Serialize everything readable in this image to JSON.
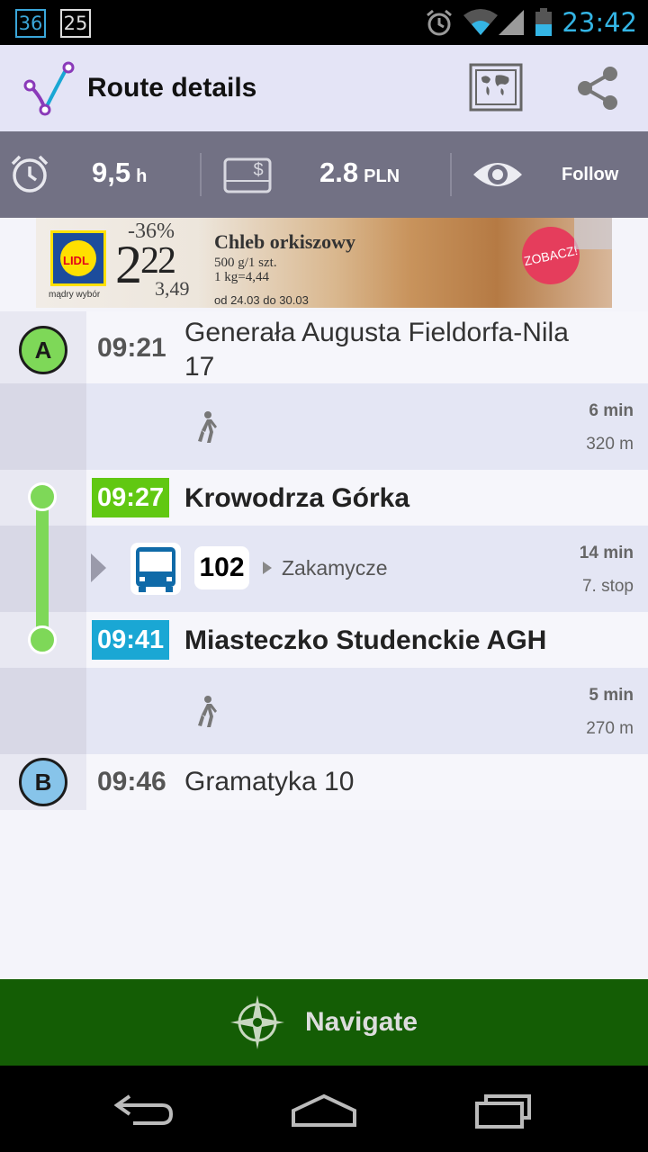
{
  "status_bar": {
    "notifications": [
      "36",
      "25"
    ],
    "time": "23:42",
    "icons": [
      "alarm-icon",
      "wifi-icon",
      "signal-icon",
      "battery-icon"
    ]
  },
  "action_bar": {
    "title": "Route details",
    "icons": [
      "app-logo-icon",
      "map-icon",
      "share-icon"
    ]
  },
  "summary": {
    "duration_value": "9,5",
    "duration_unit": "h",
    "price_value": "2.8",
    "price_unit": "PLN",
    "follow_label": "Follow",
    "icons": [
      "alarm-clock-icon",
      "ticket-icon",
      "eye-icon"
    ]
  },
  "ad": {
    "brand": "LIDL",
    "tagline": "mądry wybór",
    "discount": "-36%",
    "price_int": "2",
    "price_dec": "22",
    "old_price": "3,49",
    "product": "Chleb orkiszowy",
    "size": "500 g/1 szt.",
    "unit_price": "1 kg=4,44",
    "dates": "od 24.03 do 30.03",
    "cta": "ZOBACZ!"
  },
  "route": {
    "start": {
      "marker": "A",
      "time": "09:21",
      "name_line1": "Generała Augusta Fieldorfa-Nila",
      "name_line2": "17"
    },
    "walk1": {
      "duration": "6 min",
      "distance": "320 m"
    },
    "board": {
      "time": "09:27",
      "name": "Krowodrza Górka"
    },
    "ride": {
      "line": "102",
      "direction": "Zakamycze",
      "duration": "14 min",
      "stops": "7. stop"
    },
    "alight": {
      "time": "09:41",
      "name": "Miasteczko Studenckie AGH"
    },
    "walk2": {
      "duration": "5 min",
      "distance": "270 m"
    },
    "end": {
      "marker": "B",
      "time": "09:46",
      "name": "Gramatyka 10"
    }
  },
  "navigate": {
    "label": "Navigate"
  },
  "colors": {
    "action_bar": "#e4e4f6",
    "summary_bar": "#727184",
    "ride_green": "#7ed858",
    "board_badge": "#61c812",
    "alight_badge": "#1aa7d4",
    "navigate_bg": "#145d05",
    "status_accent": "#34b5e5"
  },
  "system_nav": [
    "back-icon",
    "home-icon",
    "recents-icon"
  ]
}
